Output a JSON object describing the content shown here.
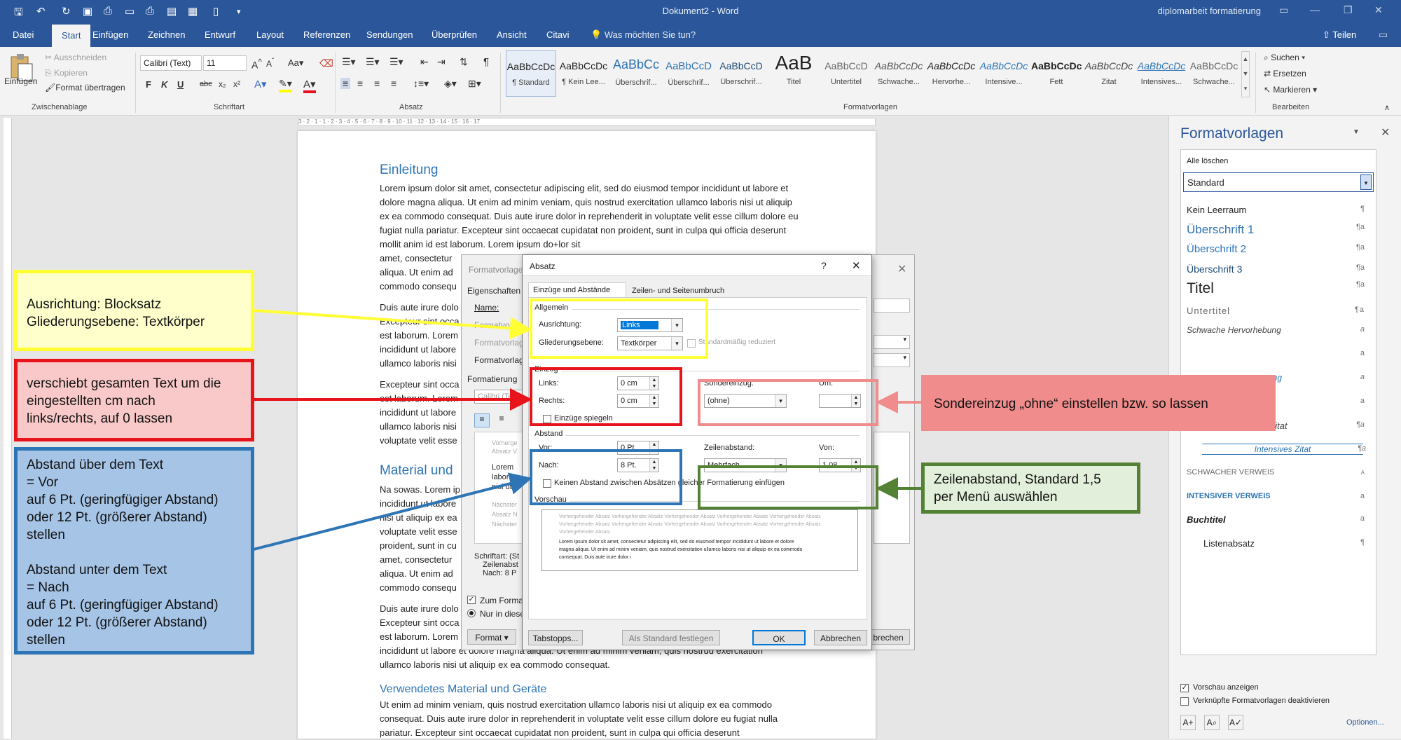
{
  "titlebar": {
    "title": "Dokument2 - Word",
    "user": "diplomarbeit formatierung",
    "qa_icons": [
      "save-icon",
      "undo-icon",
      "redo-icon",
      "save-as-icon",
      "print-preview-icon",
      "open-icon",
      "print-icon",
      "table-view-icon",
      "table-icon",
      "new-doc-icon",
      "customize-icon"
    ]
  },
  "tabs": [
    "Datei",
    "Start",
    "Einfügen",
    "Zeichnen",
    "Entwurf",
    "Layout",
    "Referenzen",
    "Sendungen",
    "Überprüfen",
    "Ansicht",
    "Citavi"
  ],
  "active_tab": "Start",
  "tellme": "Was möchten Sie tun?",
  "share": "Teilen",
  "ribbon": {
    "clipboard": {
      "paste": "Einfügen",
      "cut": "Ausschneiden",
      "copy": "Kopieren",
      "format_painter": "Format übertragen",
      "label": "Zwischenablage"
    },
    "font": {
      "name": "Calibri (Text)",
      "size": "11",
      "bold": "F",
      "italic": "K",
      "underline": "U",
      "strike": "abc",
      "sub": "x₂",
      "sup": "x²",
      "label": "Schriftart"
    },
    "paragraph": {
      "label": "Absatz"
    },
    "styles": {
      "label": "Formatvorlagen",
      "items": [
        {
          "preview": "AaBbCcDc",
          "name": "¶ Standard"
        },
        {
          "preview": "AaBbCcDc",
          "name": "¶ Kein Lee..."
        },
        {
          "preview": "AaBbCc",
          "name": "Überschrif..."
        },
        {
          "preview": "AaBbCcD",
          "name": "Überschrif..."
        },
        {
          "preview": "AaBbCcD",
          "name": "Überschrif..."
        },
        {
          "preview": "AaB",
          "name": "Titel"
        },
        {
          "preview": "AaBbCcD",
          "name": "Untertitel"
        },
        {
          "preview": "AaBbCcDc",
          "name": "Schwache..."
        },
        {
          "preview": "AaBbCcDc",
          "name": "Hervorhe..."
        },
        {
          "preview": "AaBbCcDc",
          "name": "Intensive..."
        },
        {
          "preview": "AaBbCcDc",
          "name": "Fett"
        },
        {
          "preview": "AaBbCcDc",
          "name": "Zitat"
        },
        {
          "preview": "AaBbCcDc",
          "name": "Intensives..."
        },
        {
          "preview": "AaBbCcDc",
          "name": "Schwache..."
        }
      ]
    },
    "editing": {
      "find": "Suchen",
      "replace": "Ersetzen",
      "select": "Markieren",
      "label": "Bearbeiten"
    }
  },
  "ruler": "3 · 2 · 1 · 1 · 2 · 3 · 4 · 5 · 6 · 7 · 8 · 9 · 10 · 11 · 12 · 13 · 14 · 15 · 16 · 17",
  "document": {
    "h1": "Einleitung",
    "p1": "Lorem ipsum dolor sit amet, consectetur adipiscing elit, sed do eiusmod tempor incididunt ut labore et dolore magna aliqua. Ut enim ad minim veniam, quis nostrud exercitation ullamco laboris nisi ut aliquip ex ea commodo consequat. Duis aute irure dolor in reprehenderit in voluptate velit esse cillum dolore eu fugiat nulla pariatur. Excepteur sint occaecat cupidatat non proident, sunt in culpa qui officia deserunt mollit anim id est laborum. Lorem ipsum do+lor sit",
    "p1b": "amet, consectetur",
    "p1c": "aliqua. Ut enim ad",
    "p1d": "commodo consequ",
    "p2a": "Duis aute irure dolo",
    "p2b": "Excepteur sint occa",
    "p2c": "est laborum. Lorem",
    "p2d": "incididunt ut labore",
    "p2e": "ullamco laboris nisi",
    "p3a": "Excepteur sint occa",
    "p3b": "est laborum. Lorem",
    "p3c": "incididunt ut labore",
    "p3d": "ullamco laboris nisi",
    "p3e": "voluptate velit esse",
    "h2": "Material und",
    "p4a": "Na sowas. Lorem ip",
    "p4b": "incididunt ut labore",
    "p4c": "nisi ut aliquip ex ea",
    "p4d": "voluptate velit esse",
    "p4e": "proident, sunt in cu",
    "p4f": "amet, consectetur",
    "p4g": "aliqua. Ut enim ad",
    "p4h": "commodo consequ",
    "p5a": "Duis aute irure dolo",
    "p5b": "Excepteur sint occa",
    "p5c": "est laborum. Lorem",
    "p5d": "incididunt ut labore et dolore magna aliqua. Ut enim ad minim veniam, quis nostrud exercitation",
    "p5e": "ullamco laboris nisi ut aliquip ex ea commodo consequat.",
    "h3": "Verwendetes Material und Geräte",
    "p6": "Ut enim ad minim veniam, quis nostrud exercitation ullamco laboris nisi ut aliquip ex ea commodo consequat. Duis aute irure dolor in reprehenderit in voluptate velit esse cillum dolore eu fugiat nulla pariatur. Excepteur sint occaecat cupidatat non proident, sunt in culpa qui officia deserunt"
  },
  "bg_dialog": {
    "title": "Formatvorlage",
    "props": "Eigenschaften",
    "name": "Name:",
    "fv1": "Formatvorla",
    "fv2": "Formatvorlag",
    "fv3": "Formatvorlag",
    "formatierung": "Formatierung",
    "font": "Calibri (Tex",
    "prev1": "Vorherge",
    "prev2": "Absatz V",
    "prev3": "Lorem",
    "prev4": "labore e",
    "prev5": "nisi ut a",
    "prev6": "Nächster",
    "prev7": "Absatz N",
    "prev8": "Nächster",
    "desc1": "Schriftart: (St",
    "desc2": "Zeilenabst",
    "desc3": "Nach: 8 P",
    "cb1": "Zum Format",
    "rb1": "Nur in diese",
    "format_btn": "Format ▾",
    "cancel_btn": "brechen"
  },
  "dialog": {
    "title": "Absatz",
    "help": "?",
    "close": "✕",
    "tab1": "Einzüge und Abstände",
    "tab2": "Zeilen- und Seitenumbruch",
    "allgemein": "Allgemein",
    "ausrichtung_label": "Ausrichtung:",
    "ausrichtung_value": "Links",
    "gliederung_label": "Gliederungsebene:",
    "gliederung_value": "Textkörper",
    "reduziert": "Standardmäßig reduziert",
    "einzug": "Einzug",
    "links_label": "Links:",
    "links_value": "0 cm",
    "rechts_label": "Rechts:",
    "rechts_value": "0 cm",
    "sondereinzug_label": "Sondereinzug:",
    "sondereinzug_value": "(ohne)",
    "um_label": "Um:",
    "um_value": "",
    "spiegeln": "Einzüge spiegeln",
    "abstand": "Abstand",
    "vor_label": "Vor:",
    "vor_value": "0 Pt.",
    "nach_label": "Nach:",
    "nach_value": "8 Pt.",
    "zeilenabstand_label": "Zeilenabstand:",
    "zeilenabstand_value": "Mehrfach",
    "von_label": "Von:",
    "von_value": "1,08",
    "kein_abstand": "Keinen Abstand zwischen Absätzen gleicher Formatierung einfügen",
    "vorschau": "Vorschau",
    "preview_grey1": "Vorhergehender Absatz Vorhergehender Absatz Vorhergehender Absatz Vorhergehender Absatz Vorhergehender Absatz",
    "preview_grey2": "Vorhergehender Absatz Vorhergehender Absatz Vorhergehender Absatz Vorhergehender Absatz Vorhergehender Absatz",
    "preview_grey3": "Vorhergehender Absatz",
    "preview_text1": "Lorem ipsum dolor sit amet, consectetur adipiscing elit, sed do eiusmod tempor incididunt ut labore et dolore",
    "preview_text2": "magna aliqua. Ut enim ad minim veniam, quis nostrud exercitation ullamco laboris nisi ut aliquip ex ea commodo",
    "preview_text3": "consequat. Duis aute irure dolor i",
    "tabstopps": "Tabstopps...",
    "als_standard": "Als Standard festlegen",
    "ok": "OK",
    "abbrechen": "Abbrechen"
  },
  "styles_pane": {
    "title": "Formatvorlagen",
    "clear_all": "Alle löschen",
    "selected": "Standard",
    "items": [
      {
        "name": "Kein Leerraum",
        "mark": "¶"
      },
      {
        "name": "Überschrift 1",
        "mark": "¶a"
      },
      {
        "name": "Überschrift 2",
        "mark": "¶a"
      },
      {
        "name": "Überschrift 3",
        "mark": "¶a"
      },
      {
        "name": "Titel",
        "mark": "¶a"
      },
      {
        "name": "Untertitel",
        "mark": "¶a"
      },
      {
        "name": "Schwache Hervorhebung",
        "mark": "a"
      },
      {
        "name": "",
        "mark": "a"
      },
      {
        "name": "ung",
        "mark": "a"
      },
      {
        "name": "",
        "mark": "a"
      },
      {
        "name": "Zitat",
        "mark": "¶a"
      },
      {
        "name": "Intensives Zitat",
        "mark": "¶a"
      },
      {
        "name": "Schwacher Verweis",
        "mark": "a"
      },
      {
        "name": "Intensiver Verweis",
        "mark": "a"
      },
      {
        "name": "Buchtitel",
        "mark": "a"
      },
      {
        "name": "Listenabsatz",
        "mark": "¶"
      }
    ],
    "show_preview": "Vorschau anzeigen",
    "disable_linked": "Verknüpfte Formatvorlagen deaktivieren",
    "options": "Optionen..."
  },
  "annotations": {
    "yellow": {
      "lines": [
        "Ausrichtung: Blocksatz",
        "Gliederungsebene: Textkörper"
      ],
      "color": "#ffff33",
      "fill": "#ffffcc"
    },
    "red": {
      "lines": [
        "verschiebt gesamten Text um die",
        "eingestellten cm nach",
        "links/rechts, auf 0 lassen"
      ],
      "color": "#e8141c",
      "fill": "#f9c9c9"
    },
    "blue": {
      "lines": [
        "Abstand über dem Text",
        "= Vor",
        "auf 6 Pt. (geringfügiger Abstand)",
        "oder 12 Pt. (größerer Abstand)",
        "stellen",
        "",
        "Abstand unter dem Text",
        "= Nach",
        "auf 6 Pt. (geringfügiger Abstand)",
        "oder 12 Pt. (größerer Abstand)",
        "stellen"
      ],
      "color": "#2e75b6",
      "fill": "#a5c4e6"
    },
    "pink": {
      "lines": [
        "Sondereinzug „ohne“ einstellen bzw. so lassen"
      ],
      "color": "#f08c8c",
      "fill": "#f08c8c"
    },
    "green": {
      "lines": [
        "Zeilenabstand, Standard 1,5",
        "per Menü auswählen"
      ],
      "color": "#548235",
      "fill": "#e2efda"
    }
  }
}
